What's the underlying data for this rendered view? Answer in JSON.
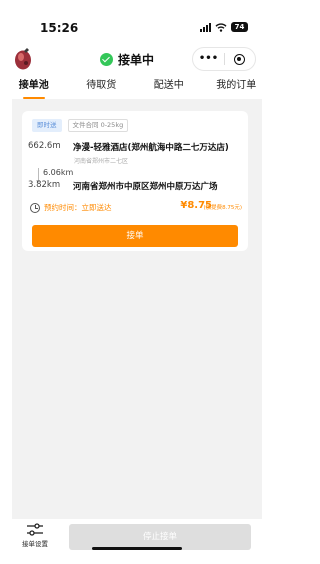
{
  "status": {
    "time": "15:26",
    "battery": "74"
  },
  "header": {
    "title": "接单中",
    "more": "•••"
  },
  "tabs": [
    {
      "label": "接单池",
      "active": true
    },
    {
      "label": "待取货",
      "active": false
    },
    {
      "label": "配送中",
      "active": false
    },
    {
      "label": "我的订单",
      "active": false
    }
  ],
  "order": {
    "tag_type": "即时送",
    "tag_spec": "文件合同 0-25kg",
    "pickup": {
      "distance": "662.6m",
      "name": "净漫-轻雅酒店(郑州航海中路二七万达店)",
      "region": "河南省郑州市二七区"
    },
    "route_distance": "6.06km",
    "dropoff": {
      "distance": "3.82km",
      "name": "河南省郑州市中原区郑州中原万达广场"
    },
    "time_label": "预约时间：立即送达",
    "price": "¥8.75",
    "price_note": "(加提费8.75元)",
    "accept_label": "接单"
  },
  "bottom": {
    "settings_label": "接单设置",
    "stop_label": "停止接单"
  },
  "colors": {
    "accent": "#ff8a00",
    "success": "#34c759",
    "tag_blue": "#5b8fd9"
  }
}
